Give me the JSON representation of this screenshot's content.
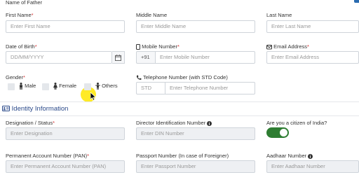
{
  "top": {
    "father_label": "Name of Father"
  },
  "row1": {
    "first_name": {
      "label": "First Name",
      "required": "*",
      "placeholder": "Enter First Name"
    },
    "middle_name": {
      "label": "Middle Name",
      "placeholder": "Enter Middle Name"
    },
    "last_name": {
      "label": "Last Name",
      "placeholder": "Enter Last Name"
    }
  },
  "row2": {
    "dob": {
      "label": "Date of Birth",
      "required": "*",
      "placeholder": "DD/MM/YYYY"
    },
    "mobile": {
      "label": "Mobile Number",
      "required": "*",
      "prefix": "+91",
      "placeholder": "Enter Mobile Number"
    },
    "email": {
      "label": "Email Address",
      "required": "*",
      "placeholder": "Enter Email Address"
    }
  },
  "row3": {
    "gender": {
      "label": "Gender",
      "required": "*",
      "options": [
        "Male",
        "Female",
        "Others"
      ]
    },
    "telephone": {
      "label": "Telephone Number (with STD Code)",
      "std_placeholder": "STD",
      "placeholder": "Enter Telephone Number"
    }
  },
  "identity": {
    "section_title": "Identity Information",
    "designation": {
      "label": "Designation / Status",
      "required": "*",
      "placeholder": "Enter Designation"
    },
    "din": {
      "label": "Director Identification Number",
      "placeholder": "Enter DIN Number"
    },
    "citizen": {
      "label": "Are you a citizen of India?",
      "value": true
    },
    "pan": {
      "label": "Permanent Account Number (PAN)",
      "required": "*",
      "placeholder": "Enter Permanent Account Number (PAN)"
    },
    "passport": {
      "label": "Passport Number (In case of Foreigner)",
      "placeholder": "Enter Passport Number"
    },
    "aadhaar": {
      "label": "Aadhaar Number",
      "placeholder": "Enter Aadhaar Number"
    }
  },
  "colors": {
    "accent": "#2b4a8a",
    "required": "#d32f2f",
    "toggle_on": "#2e7d32",
    "cursor_highlight": "#ffe600"
  }
}
